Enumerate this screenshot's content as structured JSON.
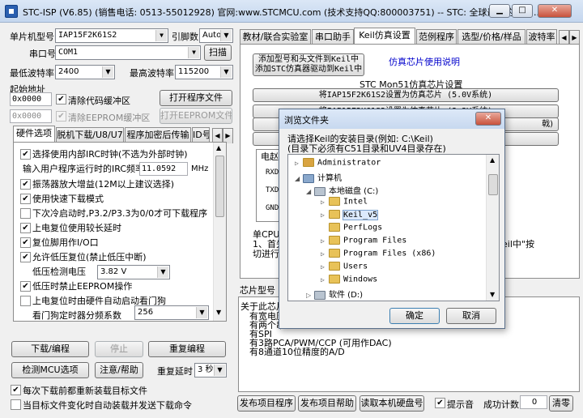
{
  "window": {
    "title": "STC-ISP (V6.85) (销售电话: 0513-55012928) 官网:www.STCMCU.com  (技术支持QQ:800003751)  -- STC: 全球最大的805..."
  },
  "left": {
    "mcu_type_label": "单片机型号",
    "mcu_type": "IAP15F2K61S2",
    "pin_label": "引脚数",
    "pin_value": "Auto",
    "serial_label": "串口号",
    "serial_value": "COM1",
    "scan_btn": "扫描",
    "min_baud_label": "最低波特率",
    "min_baud": "2400",
    "max_baud_label": "最高波特率",
    "max_baud": "115200",
    "start_addr_label": "起始地址",
    "code_addr": "0x0000",
    "clear_code_label": "清除代码缓冲区",
    "open_prog_btn": "打开程序文件",
    "eeprom_addr": "0x0000",
    "clear_eeprom_label": "清除EEPROM缓冲区",
    "open_eeprom_btn": "打开EEPROM文件",
    "tabs": [
      "硬件选项",
      "脱机下载/U8/U7",
      "程序加密后传输",
      "ID号"
    ],
    "options": [
      {
        "label": "选择使用内部IRC时钟(不选为外部时钟)",
        "checked": true
      },
      {
        "label": "输入用户程序运行时的IRC频率",
        "value": "11.0592",
        "unit": "MHz"
      },
      {
        "label": "振荡器放大增益(12M以上建议选择)",
        "checked": true
      },
      {
        "label": "使用快速下载模式",
        "checked": true
      },
      {
        "label": "下次冷启动时,P3.2/P3.3为0/0才可下载程序",
        "checked": false
      },
      {
        "label": "上电复位使用较长延时",
        "checked": true
      },
      {
        "label": "复位脚用作I/O口",
        "checked": true
      },
      {
        "label": "允许低压复位(禁止低压中断)",
        "checked": true
      },
      {
        "label": "低压检测电压",
        "value": "3.82 V"
      },
      {
        "label": "低压时禁止EEPROM操作",
        "checked": true
      },
      {
        "label": "上电复位时由硬件自动启动看门狗",
        "checked": false
      },
      {
        "label": "看门狗定时器分频系数",
        "value": "256"
      }
    ],
    "download_btn": "下载/编程",
    "stop_btn": "停止",
    "reprogram_btn": "重复编程",
    "detect_btn": "检测MCU选项",
    "help_btn": "注意/帮助",
    "repeat_delay_label": "重复延时",
    "repeat_delay": "3 秒",
    "reload_label": "每次下载前都重新装载目标文件",
    "auto_send_label": "当目标文件变化时自动装载并发送下载命令"
  },
  "right": {
    "tabs": [
      "教材/联合实验室",
      "串口助手",
      "Keil仿真设置",
      "范例程序",
      "选型/价格/样品",
      "波特率"
    ],
    "add_keil_btn_1": "添加型号和头文件到Keil中",
    "add_keil_btn_2": "添加STC仿真器驱动到Keil中",
    "sim_help_link": "仿真芯片使用说明",
    "mon51_title": "STC Mon51仿真芯片设置",
    "set_5v_btn": "将IAP15F2K61S2设置为仿真芯片 (5.0V系统)",
    "set_33v_btn": "将IAP15F2K61S2设置为仿真芯片 (3.3V系统)",
    "row3_tail": "戟)",
    "circuit_label": "电赵",
    "pin_rxd": "RXD",
    "pin_txd": "TXD",
    "pin_gnd": "GND",
    "note_1": "单CPU",
    "note_2": "1、首先",
    "note_3": "切进行",
    "note_tail": "eil中\"按",
    "chip_label": "芯片型号",
    "about_text": [
      "关于此芯片",
      "有宽电压",
      "有两个串",
      "有SPI",
      "有3路PCA/PWM/CCP (可用作DAC)",
      "有8通道10位精度的A/D"
    ],
    "publish_prog_btn": "发布项目程序",
    "publish_help_btn": "发布项目帮助",
    "read_disk_btn": "读取本机硬盘号",
    "prompt_label": "提示音",
    "success_label": "成功计数",
    "success_count": "0",
    "clear_btn": "清零"
  },
  "dialog": {
    "title": "浏览文件夹",
    "prompt_1": "请选择Keil的安装目录(例如: C:\\Keil)",
    "prompt_2": "(目录下必须有C51目录和UV4目录存在)",
    "tree": [
      {
        "label": "Administrator",
        "level": 0,
        "expander": "▷"
      },
      {
        "label": "计算机",
        "level": 0,
        "expander": "◢"
      },
      {
        "label": "本地磁盘 (C:)",
        "level": 1,
        "expander": "◢"
      },
      {
        "label": "Intel",
        "level": 2,
        "expander": "▷"
      },
      {
        "label": "Keil_v5",
        "level": 2,
        "expander": "▷",
        "selected": true
      },
      {
        "label": "PerfLogs",
        "level": 2,
        "expander": ""
      },
      {
        "label": "Program Files",
        "level": 2,
        "expander": "▷"
      },
      {
        "label": "Program Files (x86)",
        "level": 2,
        "expander": "▷"
      },
      {
        "label": "Users",
        "level": 2,
        "expander": "▷"
      },
      {
        "label": "Windows",
        "level": 2,
        "expander": "▷"
      },
      {
        "label": "软件 (D:)",
        "level": 1,
        "expander": "▷"
      }
    ],
    "ok_btn": "确定",
    "cancel_btn": "取消"
  }
}
